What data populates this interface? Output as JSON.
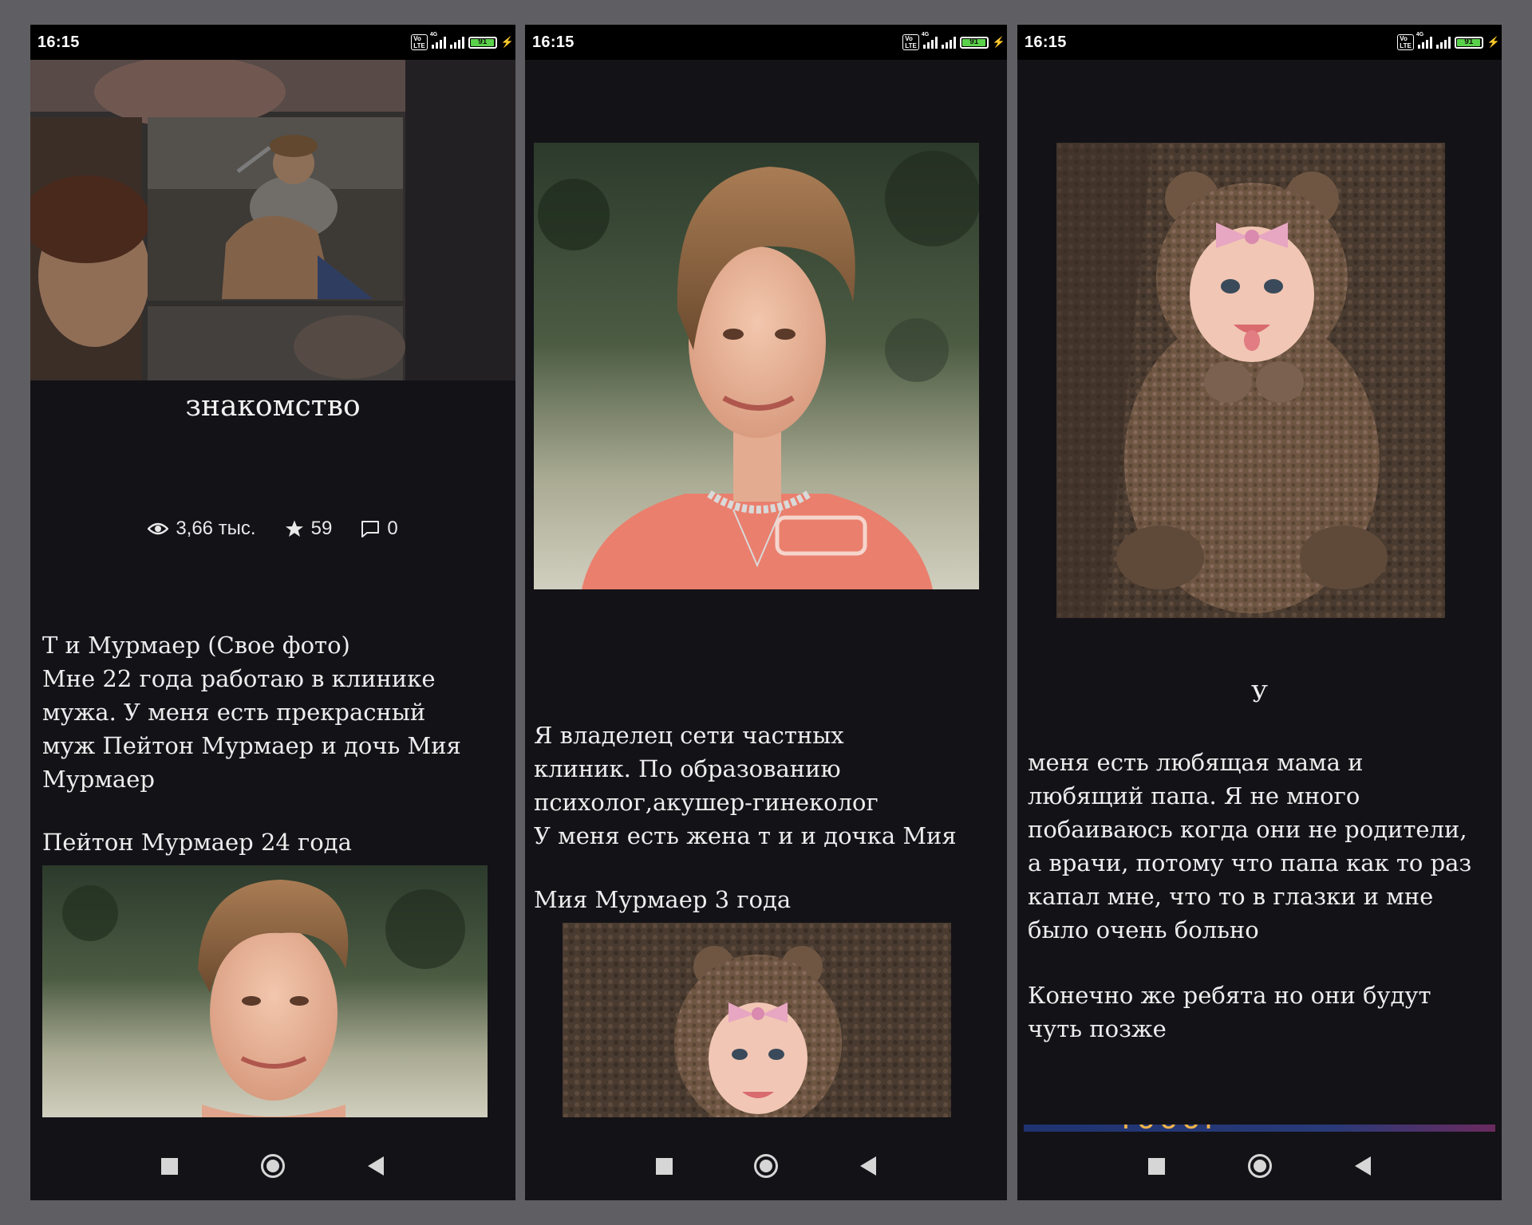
{
  "status_bar": {
    "time": "16:15",
    "volte": "VoLTE",
    "network": "4G",
    "battery_level": "91"
  },
  "story": {
    "title": "знакомство",
    "stats": {
      "views": "3,66 тыс.",
      "stars": "59",
      "comments": "0"
    }
  },
  "screen1": {
    "paragraph1": "Т и Мурмаер (Свое фото)\nМне 22 года работаю в клинике\nмужа. У меня есть прекрасный\nмуж Пейтон Мурмаер и дочь Мия\nМурмаер",
    "paragraph2": "Пейтон Мурмаер 24 года"
  },
  "screen2": {
    "paragraph1": "Я владелец сети частных\nклиник. По образованию\nпсихолог,акушер-гинеколог\nУ меня есть жена т и и дочка Мия",
    "paragraph2": "Мия Мурмаер 3 года"
  },
  "screen3": {
    "heading_letter": "У",
    "paragraph1": "меня есть любящая мама и\nлюбящий папа. Я не много\nпобаиваюсь когда они не родители,\nа врачи, потому что папа как то раз\nкапал мне, что то в глазки и мне\nбыло очень больно",
    "paragraph2": "Конечно же ребята но они будут\nчуть позже"
  },
  "colors": {
    "background": "#131217",
    "frame": "#5f5e63",
    "text": "#ededed"
  },
  "icons": [
    "eye-icon",
    "star-icon",
    "comment-icon",
    "recent-apps-icon",
    "home-icon",
    "back-icon"
  ]
}
